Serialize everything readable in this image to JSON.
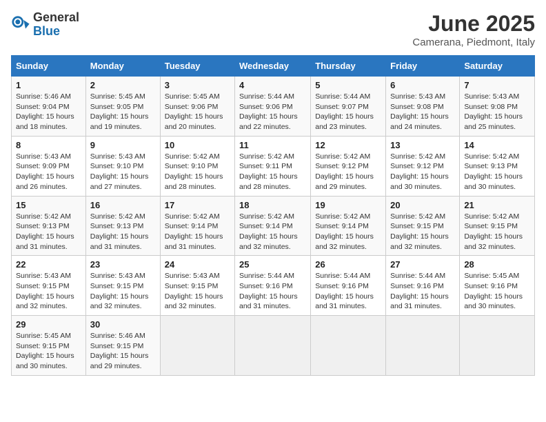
{
  "header": {
    "logo": {
      "general": "General",
      "blue": "Blue"
    },
    "title": "June 2025",
    "location": "Camerana, Piedmont, Italy"
  },
  "calendar": {
    "days_of_week": [
      "Sunday",
      "Monday",
      "Tuesday",
      "Wednesday",
      "Thursday",
      "Friday",
      "Saturday"
    ],
    "weeks": [
      [
        null,
        {
          "day": "2",
          "sunrise": "Sunrise: 5:45 AM",
          "sunset": "Sunset: 9:05 PM",
          "daylight": "Daylight: 15 hours and 19 minutes."
        },
        {
          "day": "3",
          "sunrise": "Sunrise: 5:45 AM",
          "sunset": "Sunset: 9:06 PM",
          "daylight": "Daylight: 15 hours and 20 minutes."
        },
        {
          "day": "4",
          "sunrise": "Sunrise: 5:44 AM",
          "sunset": "Sunset: 9:06 PM",
          "daylight": "Daylight: 15 hours and 22 minutes."
        },
        {
          "day": "5",
          "sunrise": "Sunrise: 5:44 AM",
          "sunset": "Sunset: 9:07 PM",
          "daylight": "Daylight: 15 hours and 23 minutes."
        },
        {
          "day": "6",
          "sunrise": "Sunrise: 5:43 AM",
          "sunset": "Sunset: 9:08 PM",
          "daylight": "Daylight: 15 hours and 24 minutes."
        },
        {
          "day": "7",
          "sunrise": "Sunrise: 5:43 AM",
          "sunset": "Sunset: 9:08 PM",
          "daylight": "Daylight: 15 hours and 25 minutes."
        }
      ],
      [
        {
          "day": "1",
          "sunrise": "Sunrise: 5:46 AM",
          "sunset": "Sunset: 9:04 PM",
          "daylight": "Daylight: 15 hours and 18 minutes."
        },
        null,
        null,
        null,
        null,
        null,
        null
      ],
      [
        {
          "day": "8",
          "sunrise": "Sunrise: 5:43 AM",
          "sunset": "Sunset: 9:09 PM",
          "daylight": "Daylight: 15 hours and 26 minutes."
        },
        {
          "day": "9",
          "sunrise": "Sunrise: 5:43 AM",
          "sunset": "Sunset: 9:10 PM",
          "daylight": "Daylight: 15 hours and 27 minutes."
        },
        {
          "day": "10",
          "sunrise": "Sunrise: 5:42 AM",
          "sunset": "Sunset: 9:10 PM",
          "daylight": "Daylight: 15 hours and 28 minutes."
        },
        {
          "day": "11",
          "sunrise": "Sunrise: 5:42 AM",
          "sunset": "Sunset: 9:11 PM",
          "daylight": "Daylight: 15 hours and 28 minutes."
        },
        {
          "day": "12",
          "sunrise": "Sunrise: 5:42 AM",
          "sunset": "Sunset: 9:12 PM",
          "daylight": "Daylight: 15 hours and 29 minutes."
        },
        {
          "day": "13",
          "sunrise": "Sunrise: 5:42 AM",
          "sunset": "Sunset: 9:12 PM",
          "daylight": "Daylight: 15 hours and 30 minutes."
        },
        {
          "day": "14",
          "sunrise": "Sunrise: 5:42 AM",
          "sunset": "Sunset: 9:13 PM",
          "daylight": "Daylight: 15 hours and 30 minutes."
        }
      ],
      [
        {
          "day": "15",
          "sunrise": "Sunrise: 5:42 AM",
          "sunset": "Sunset: 9:13 PM",
          "daylight": "Daylight: 15 hours and 31 minutes."
        },
        {
          "day": "16",
          "sunrise": "Sunrise: 5:42 AM",
          "sunset": "Sunset: 9:13 PM",
          "daylight": "Daylight: 15 hours and 31 minutes."
        },
        {
          "day": "17",
          "sunrise": "Sunrise: 5:42 AM",
          "sunset": "Sunset: 9:14 PM",
          "daylight": "Daylight: 15 hours and 31 minutes."
        },
        {
          "day": "18",
          "sunrise": "Sunrise: 5:42 AM",
          "sunset": "Sunset: 9:14 PM",
          "daylight": "Daylight: 15 hours and 32 minutes."
        },
        {
          "day": "19",
          "sunrise": "Sunrise: 5:42 AM",
          "sunset": "Sunset: 9:14 PM",
          "daylight": "Daylight: 15 hours and 32 minutes."
        },
        {
          "day": "20",
          "sunrise": "Sunrise: 5:42 AM",
          "sunset": "Sunset: 9:15 PM",
          "daylight": "Daylight: 15 hours and 32 minutes."
        },
        {
          "day": "21",
          "sunrise": "Sunrise: 5:42 AM",
          "sunset": "Sunset: 9:15 PM",
          "daylight": "Daylight: 15 hours and 32 minutes."
        }
      ],
      [
        {
          "day": "22",
          "sunrise": "Sunrise: 5:43 AM",
          "sunset": "Sunset: 9:15 PM",
          "daylight": "Daylight: 15 hours and 32 minutes."
        },
        {
          "day": "23",
          "sunrise": "Sunrise: 5:43 AM",
          "sunset": "Sunset: 9:15 PM",
          "daylight": "Daylight: 15 hours and 32 minutes."
        },
        {
          "day": "24",
          "sunrise": "Sunrise: 5:43 AM",
          "sunset": "Sunset: 9:15 PM",
          "daylight": "Daylight: 15 hours and 32 minutes."
        },
        {
          "day": "25",
          "sunrise": "Sunrise: 5:44 AM",
          "sunset": "Sunset: 9:16 PM",
          "daylight": "Daylight: 15 hours and 31 minutes."
        },
        {
          "day": "26",
          "sunrise": "Sunrise: 5:44 AM",
          "sunset": "Sunset: 9:16 PM",
          "daylight": "Daylight: 15 hours and 31 minutes."
        },
        {
          "day": "27",
          "sunrise": "Sunrise: 5:44 AM",
          "sunset": "Sunset: 9:16 PM",
          "daylight": "Daylight: 15 hours and 31 minutes."
        },
        {
          "day": "28",
          "sunrise": "Sunrise: 5:45 AM",
          "sunset": "Sunset: 9:16 PM",
          "daylight": "Daylight: 15 hours and 30 minutes."
        }
      ],
      [
        {
          "day": "29",
          "sunrise": "Sunrise: 5:45 AM",
          "sunset": "Sunset: 9:15 PM",
          "daylight": "Daylight: 15 hours and 30 minutes."
        },
        {
          "day": "30",
          "sunrise": "Sunrise: 5:46 AM",
          "sunset": "Sunset: 9:15 PM",
          "daylight": "Daylight: 15 hours and 29 minutes."
        },
        null,
        null,
        null,
        null,
        null
      ]
    ]
  }
}
